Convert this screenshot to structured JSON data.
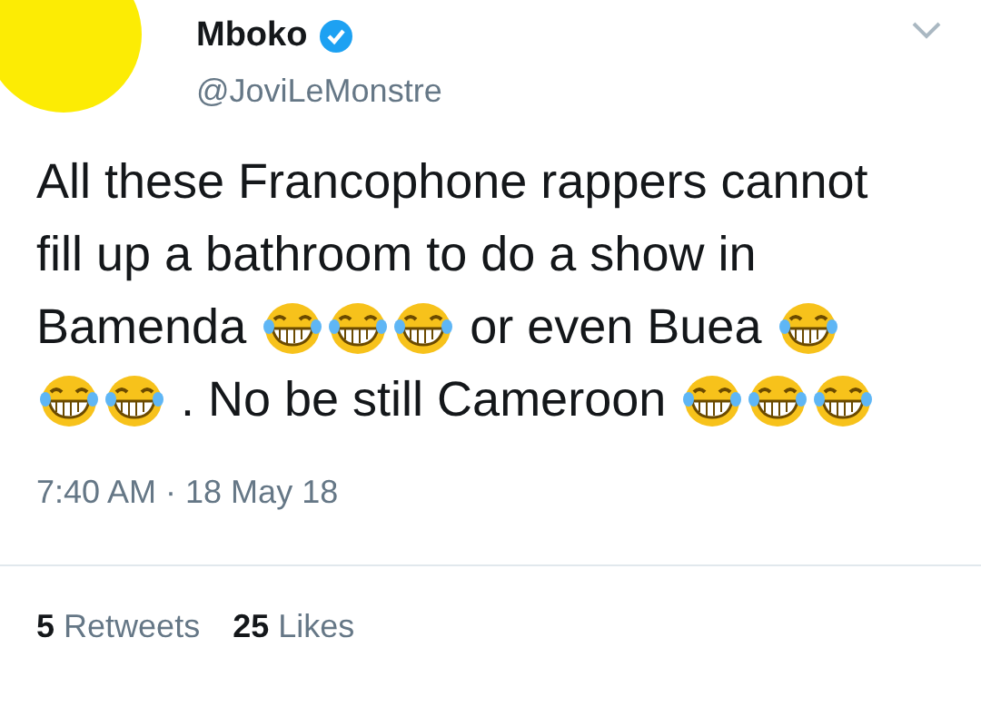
{
  "author": {
    "name": "Mboko",
    "verified": true,
    "handle": "@JoviLeMonstre"
  },
  "body": [
    {
      "kind": "text",
      "text": "All these Francophone rappers cannot fill up a bathroom to do a show in Bamenda"
    },
    {
      "kind": "emoji"
    },
    {
      "kind": "emoji"
    },
    {
      "kind": "emoji"
    },
    {
      "kind": "text",
      "text": "or even Buea"
    },
    {
      "kind": "emoji"
    },
    {
      "kind": "emoji"
    },
    {
      "kind": "emoji"
    },
    {
      "kind": "text",
      "text": ". No be still Cameroon"
    },
    {
      "kind": "emoji"
    },
    {
      "kind": "emoji"
    },
    {
      "kind": "emoji"
    }
  ],
  "timestamp": "7:40 AM · 18 May 18",
  "stats": [
    {
      "count": "5",
      "label": "Retweets"
    },
    {
      "count": "25",
      "label": "Likes"
    }
  ]
}
